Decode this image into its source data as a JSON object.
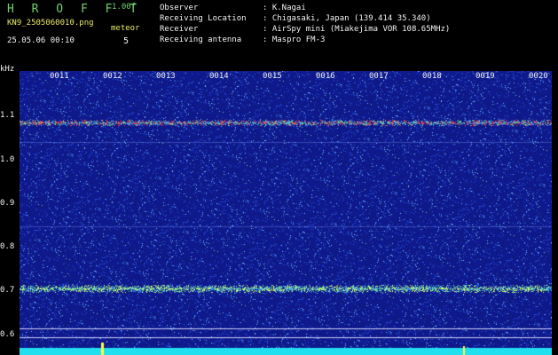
{
  "header": {
    "app_title": "H R O F F T",
    "version": "1.00f",
    "filename": "KN9_2505060010.png",
    "meteor_label": "meteor",
    "timestamp": "25.05.06 00:10",
    "meteor_count": "5"
  },
  "info": {
    "observer_label": "Observer",
    "observer_value": ": K.Nagai",
    "location_label": "Receiving Location",
    "location_value": ": Chigasaki, Japan (139.414 35.340)",
    "receiver_label": "Receiver",
    "receiver_value": ": AirSpy mini (Miakejima VOR 108.65MHz)",
    "antenna_label": "Receiving antenna",
    "antenna_value": ": Maspro FM-3"
  },
  "axis": {
    "y_unit": "kHz",
    "y_ticks": [
      "1.1",
      "1.0",
      "0.9",
      "0.8",
      "0.7",
      "0.6"
    ],
    "x_ticks": [
      "0011",
      "0012",
      "0013",
      "0014",
      "0015",
      "0016",
      "0017",
      "0018",
      "0019",
      "0020"
    ]
  },
  "colors": {
    "background": "#000000",
    "spectrum_base": "#1a2a8c",
    "carrier_line": "#ff3030",
    "green_text": "#6fd26f",
    "yellow_text": "#e8e86a"
  }
}
